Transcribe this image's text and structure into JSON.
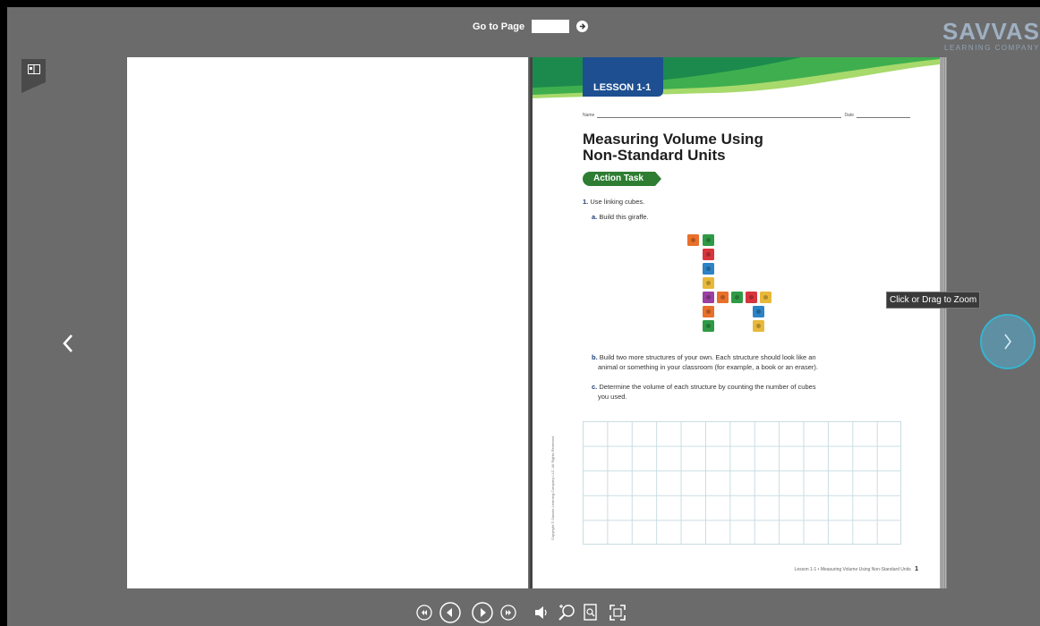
{
  "goto": {
    "label": "Go to Page",
    "value": ""
  },
  "brand": {
    "name": "SAVVAS",
    "subtitle": "LEARNING COMPANY"
  },
  "page": {
    "lesson": "LESSON 1-1",
    "name_label": "Name",
    "date_label": "Date",
    "title_line1": "Measuring Volume Using",
    "title_line2": "Non-Standard Units",
    "action_task": "Action Task",
    "q1_num": "1.",
    "q1_text": "Use linking cubes.",
    "qa_letter": "a.",
    "qa_text": "Build this giraffe.",
    "qb_letter": "b.",
    "qb_text1": "Build two more structures of your own. Each structure should look like an",
    "qb_text2": "animal or something in your classroom (for example, a book or an eraser).",
    "qc_letter": "c.",
    "qc_text1": "Determine the volume of each structure by counting the number of cubes",
    "qc_text2": "you used.",
    "copyright": "Copyright © Savvas Learning Company LLC. All Rights Reserved.",
    "footer_text": "Lesson 1-1 • Measuring Volume Using Non-Standard Units",
    "page_number": "1"
  },
  "tooltip": {
    "zoom": "Click or Drag to Zoom"
  },
  "colors": {
    "accent": "#36b4cf",
    "lesson_blue": "#1d4f91",
    "action_green": "#2e7d32",
    "viewer_bg": "#6b6b6b"
  },
  "icons": {
    "panel_toggle": "book-panel-icon",
    "prev": "chevron-left-icon",
    "next": "chevron-right-icon",
    "toolbar": [
      "first-page-icon",
      "previous-page-icon",
      "play-icon",
      "last-page-icon",
      "volume-icon",
      "zoom-icon",
      "page-view-icon",
      "fullscreen-icon"
    ]
  }
}
